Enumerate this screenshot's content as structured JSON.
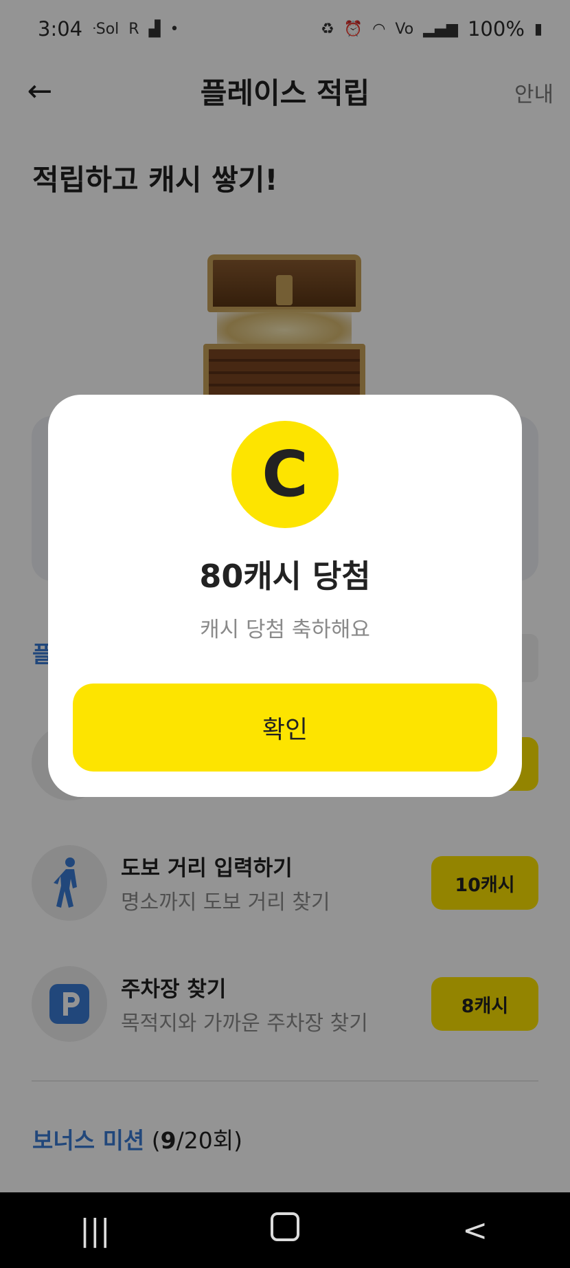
{
  "status_bar": {
    "time": "3:04",
    "left_icons": [
      "sol-bank-icon",
      "r-app-icon",
      "steps-icon",
      "dot-icon"
    ],
    "right_icons": [
      "recycle-icon",
      "alarm-icon",
      "wifi-icon",
      "volte-icon",
      "signal-icon"
    ],
    "battery": "100%"
  },
  "header": {
    "title": "플레이스 적립",
    "info_link": "안내"
  },
  "page": {
    "heading": "적립하고 캐시 쌓기!",
    "section_title": "플"
  },
  "missions": [
    {
      "title": "도보 거리 입력하기",
      "subtitle": "명소까지 도보 거리 찾기",
      "reward": "10캐시",
      "icon": "walking-person-icon"
    },
    {
      "title": "주차장 찾기",
      "subtitle": "목적지와 가까운 주차장 찾기",
      "reward": "8캐시",
      "icon": "parking-icon"
    }
  ],
  "bonus": {
    "label": "보너스 미션",
    "count_prefix": " (",
    "count_current": "9",
    "count_suffix": "/20회)"
  },
  "modal": {
    "coin_letter": "C",
    "title": "80캐시 당첨",
    "subtitle": "캐시 당첨 축하해요",
    "confirm_label": "확인"
  },
  "colors": {
    "accent_yellow": "#fde400",
    "accent_blue": "#3a7bd5",
    "parking_blue": "#3a7bd5",
    "overlay": "rgba(0,0,0,0.42)"
  }
}
